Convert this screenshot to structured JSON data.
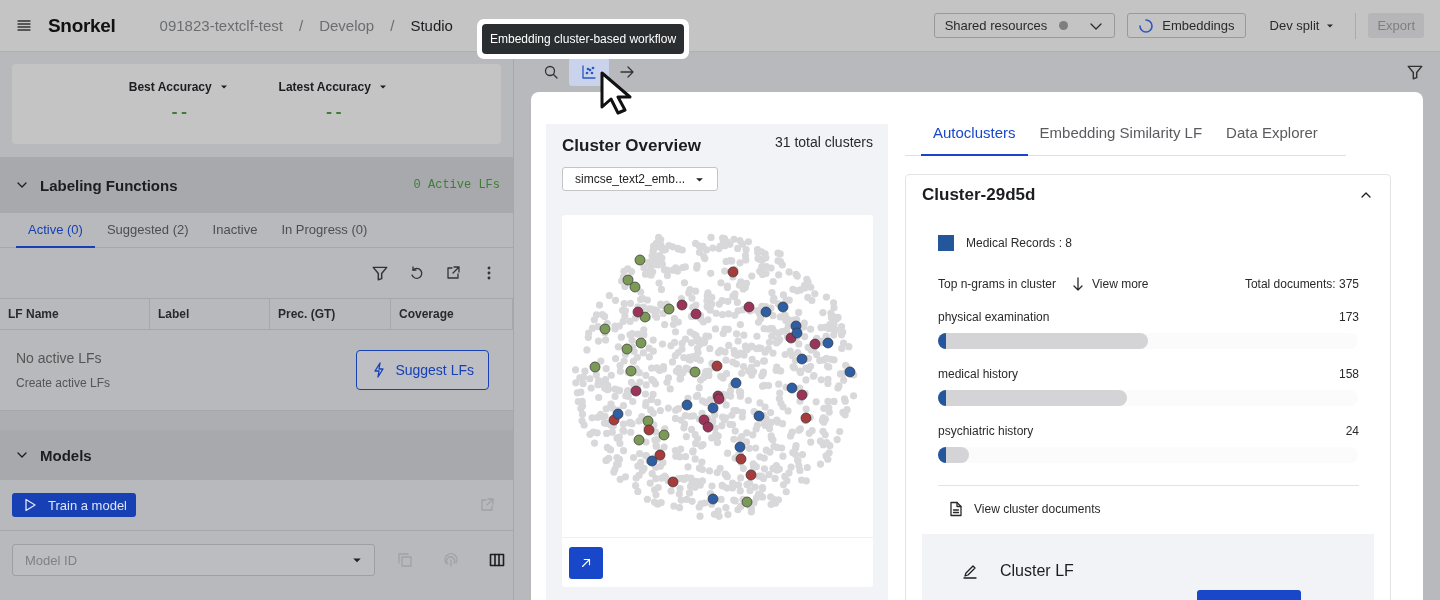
{
  "top_bar": {
    "logo": "Snorkel",
    "breadcrumbs": [
      {
        "label": "091823-textclf-test",
        "current": false
      },
      {
        "label": "Develop",
        "current": false
      },
      {
        "label": "Studio",
        "current": true
      }
    ],
    "separators": [
      "/",
      "/"
    ],
    "resources": {
      "label": "Shared resources"
    },
    "embeddings": {
      "label": "Embeddings"
    },
    "split": {
      "label": "Dev split"
    },
    "export": {
      "label": "Export",
      "disabled": true
    }
  },
  "tooltip": {
    "text": "Embedding cluster-based workflow"
  },
  "accuracy": [
    {
      "label": "Best Accuracy",
      "value": "--"
    },
    {
      "label": "Latest Accuracy",
      "value": "--"
    }
  ],
  "labeling_functions": {
    "title": "Labeling Functions",
    "count": "0 Active LFs",
    "expanded": true,
    "tabs": [
      {
        "label": "Active (0)",
        "selected": true
      },
      {
        "label": "Suggested (2)",
        "selected": false
      },
      {
        "label": "Inactive",
        "selected": false
      },
      {
        "label": "In Progress (0)",
        "selected": false
      }
    ],
    "columns": [
      "LF Name",
      "Label",
      "Prec. (GT)",
      "Coverage"
    ],
    "empty_title": "No active LFs",
    "empty_hint": "Create active LFs",
    "suggest_button": "Suggest LFs"
  },
  "models": {
    "title": "Models",
    "expanded": true,
    "train_button": "Train a model",
    "model_field": {
      "placeholder": "Model ID"
    }
  },
  "cluster_panel": {
    "overview": {
      "title": "Cluster Overview",
      "total": "31 total clusters",
      "embedding_select": "simcse_text2_emb..."
    },
    "tabs": [
      {
        "label": "Autoclusters",
        "selected": true
      },
      {
        "label": "Embedding Similarity LF",
        "selected": false
      },
      {
        "label": "Data Explorer",
        "selected": false
      }
    ],
    "cluster": {
      "name": "Cluster-29d5d",
      "expanded": true,
      "label": {
        "text": "Medical Records : 8",
        "color": "#24569b"
      },
      "ngrams_title": "Top n-grams in cluster",
      "view_more": "View more",
      "total": "Total documents: 375",
      "ngrams": [
        {
          "text": "physical examination",
          "count": "173",
          "level": 0.5
        },
        {
          "text": "medical history",
          "count": "158",
          "level": 0.45
        },
        {
          "text": "psychiatric history",
          "count": "24",
          "level": 0.074
        }
      ],
      "view_documents": "View cluster documents",
      "lf_title": "Cluster LF"
    }
  }
}
